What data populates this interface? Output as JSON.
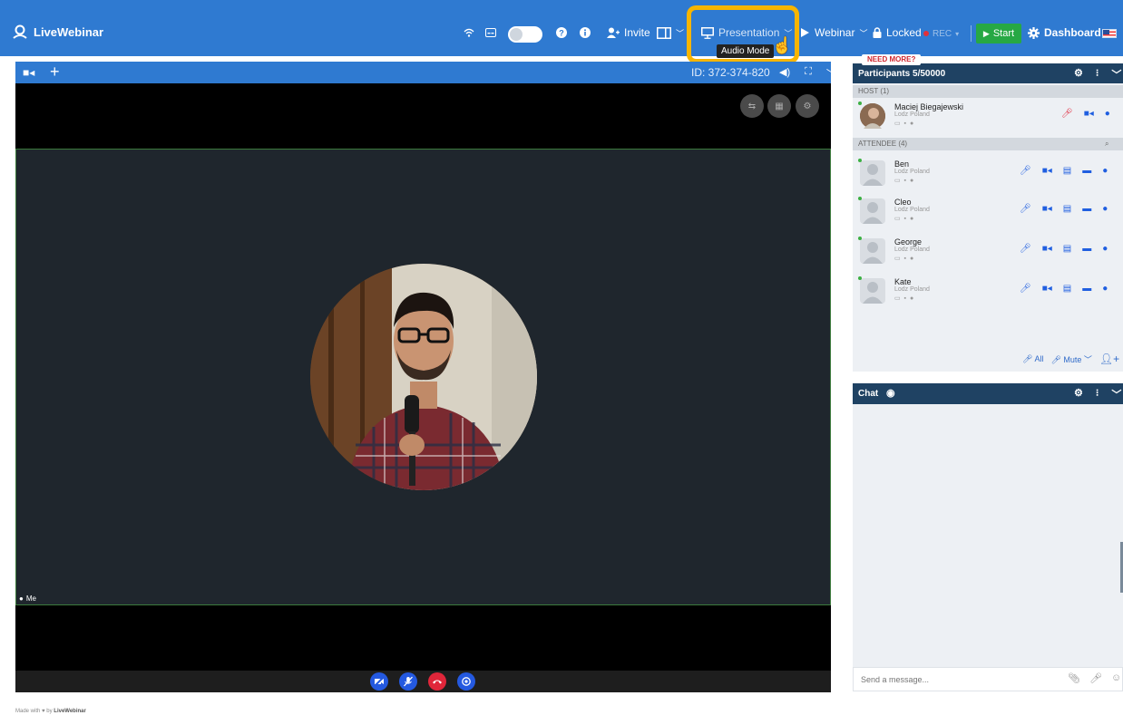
{
  "app": {
    "logo_text": "LiveWebinar"
  },
  "topbar": {
    "invite": "Invite",
    "presentation": "Presentation",
    "webinar": "Webinar",
    "locked": "Locked",
    "rec": "REC",
    "start": "Start",
    "dashboard": "Dashboard",
    "tooltip": "Audio Mode"
  },
  "video": {
    "room_id": "ID: 372-374-820",
    "me_label": "Me"
  },
  "participants": {
    "need_more": "NEED MORE?",
    "title": "Participants 5/50000",
    "host_label": "HOST",
    "host_count": "(1)",
    "attendee_label": "ATTENDEE",
    "attendee_count": "(4)",
    "host": {
      "name": "Maciej Biegajewski",
      "location": "Lodz Poland"
    },
    "attendees": [
      {
        "name": "Ben",
        "location": "Lodz Poland"
      },
      {
        "name": "Cleo",
        "location": "Lodz Poland"
      },
      {
        "name": "George",
        "location": "Lodz Poland"
      },
      {
        "name": "Kate",
        "location": "Lodz Poland"
      }
    ],
    "footer": {
      "all": "All",
      "mute": "Mute"
    }
  },
  "chat": {
    "title": "Chat",
    "placeholder": "Send a message..."
  },
  "footer": {
    "made_with": "Made with",
    "by": "by",
    "brand": "LiveWebinar"
  },
  "colors": {
    "topbar": "#2f7ad1",
    "panel_header": "#1f4263",
    "start": "#27a844",
    "highlight": "#f7b500"
  }
}
